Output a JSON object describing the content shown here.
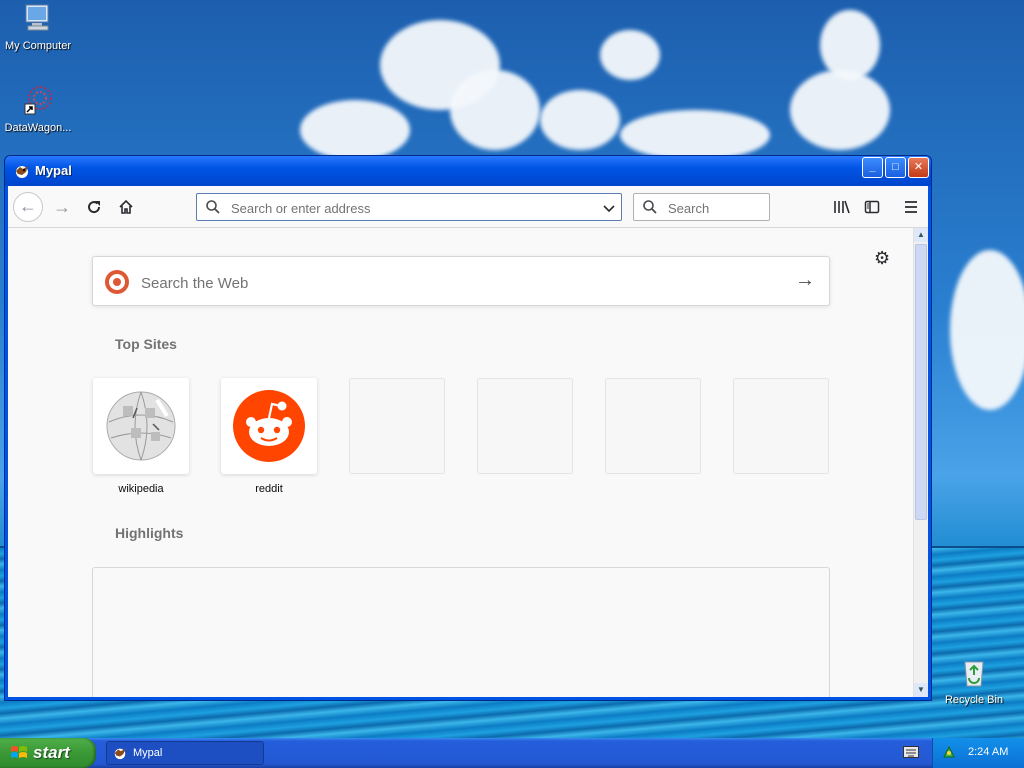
{
  "desktop": {
    "icons": [
      {
        "label": "My Computer"
      },
      {
        "label": "DataWagon..."
      },
      {
        "label": "Recycle Bin"
      }
    ]
  },
  "window": {
    "title": "Mypal",
    "controls": {
      "minimize": "_",
      "maximize": "□",
      "close": "✕"
    }
  },
  "toolbar": {
    "url_placeholder": "Search or enter address",
    "search_placeholder": "Search",
    "icons": [
      "back-icon",
      "forward-icon",
      "reload-icon",
      "home-icon",
      "library-icon",
      "sidebar-icon",
      "menu-icon"
    ]
  },
  "newtab": {
    "web_search_placeholder": "Search the Web",
    "top_sites_title": "Top Sites",
    "highlights_title": "Highlights",
    "top_sites": [
      {
        "label": "wikipedia"
      },
      {
        "label": "reddit"
      },
      {
        "label": ""
      },
      {
        "label": ""
      },
      {
        "label": ""
      },
      {
        "label": ""
      }
    ]
  },
  "taskbar": {
    "start_label": "start",
    "task_button": "Mypal",
    "clock": "2:24 AM"
  },
  "colors": {
    "accent": "#0054e3",
    "reddit": "#ff4500",
    "start": "#3c9a37"
  }
}
